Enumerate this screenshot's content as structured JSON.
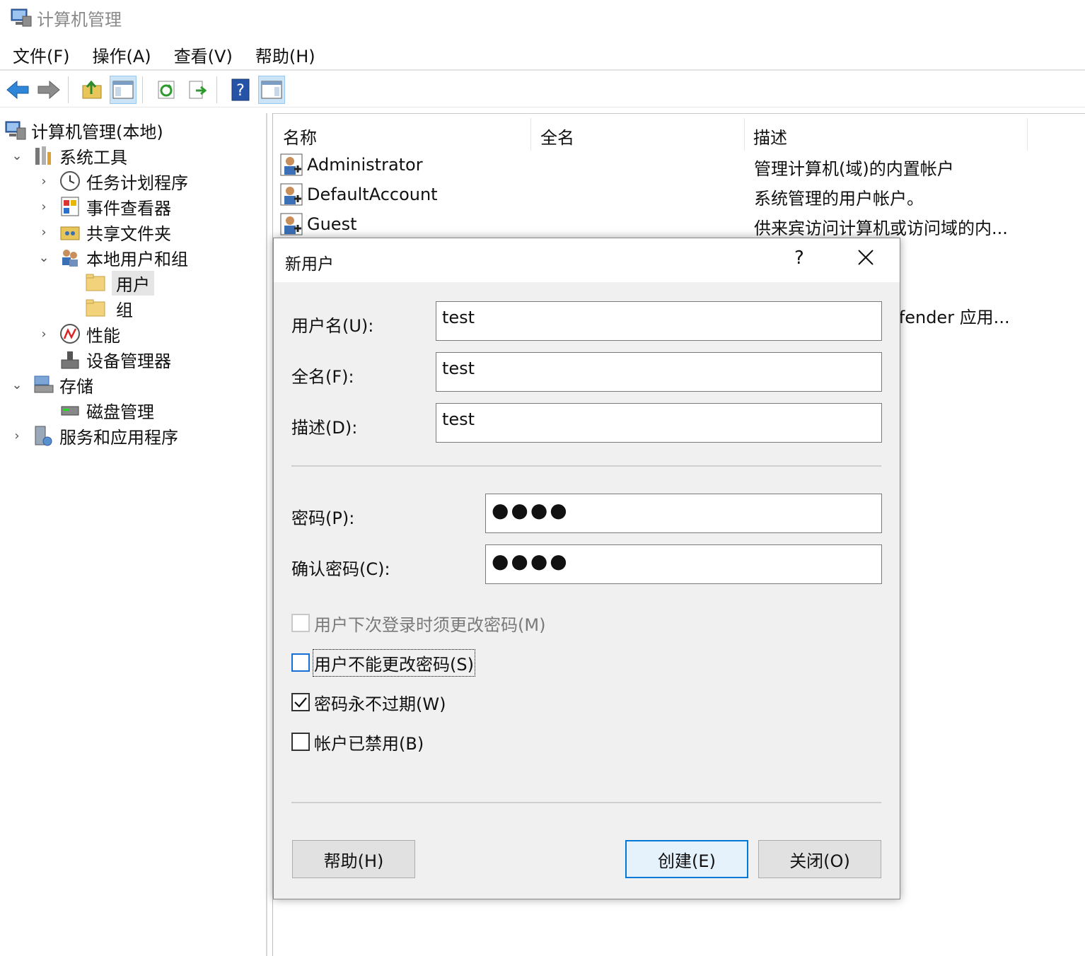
{
  "window": {
    "title": "计算机管理"
  },
  "menu": [
    "文件(F)",
    "操作(A)",
    "查看(V)",
    "帮助(H)"
  ],
  "toolbar": [
    {
      "name": "back-icon"
    },
    {
      "name": "forward-icon"
    },
    {
      "name": "up-folder-icon"
    },
    {
      "name": "show-hide-tree-icon"
    },
    {
      "name": "refresh-icon"
    },
    {
      "name": "export-list-icon"
    },
    {
      "name": "help-icon"
    },
    {
      "name": "show-action-pane-icon"
    }
  ],
  "tree": {
    "root": "计算机管理(本地)",
    "system_tools": "系统工具",
    "task_scheduler": "任务计划程序",
    "event_viewer": "事件查看器",
    "shared_folders": "共享文件夹",
    "local_users_groups": "本地用户和组",
    "users": "用户",
    "groups": "组",
    "performance": "性能",
    "device_manager": "设备管理器",
    "storage": "存储",
    "disk_management": "磁盘管理",
    "services_apps": "服务和应用程序"
  },
  "list": {
    "columns": [
      "名称",
      "全名",
      "描述"
    ],
    "rows": [
      {
        "name": "Administrator",
        "full_name": "",
        "description": "管理计算机(域)的内置帐户"
      },
      {
        "name": "DefaultAccount",
        "full_name": "",
        "description": "系统管理的用户帐户。"
      },
      {
        "name": "Guest",
        "full_name": "",
        "description": "供来宾访问计算机或访问域的内..."
      }
    ],
    "partial_row_description": "efender 应用..."
  },
  "dialog": {
    "title": "新用户",
    "help_glyph": "?",
    "username_label": "用户名(U):",
    "username_value": "test",
    "fullname_label": "全名(F):",
    "fullname_value": "test",
    "description_label": "描述(D):",
    "description_value": "test",
    "password_label": "密码(P):",
    "password_value": "●●●●",
    "confirm_label": "确认密码(C):",
    "confirm_value": "●●●●",
    "must_change_label": "用户下次登录时须更改密码(M)",
    "must_change_checked": false,
    "cannot_change_label": "用户不能更改密码(S)",
    "cannot_change_checked": false,
    "never_expires_label": "密码永不过期(W)",
    "never_expires_checked": true,
    "disabled_label": "帐户已禁用(B)",
    "disabled_checked": false,
    "help_button": "帮助(H)",
    "create_button": "创建(E)",
    "close_button": "关闭(O)"
  }
}
